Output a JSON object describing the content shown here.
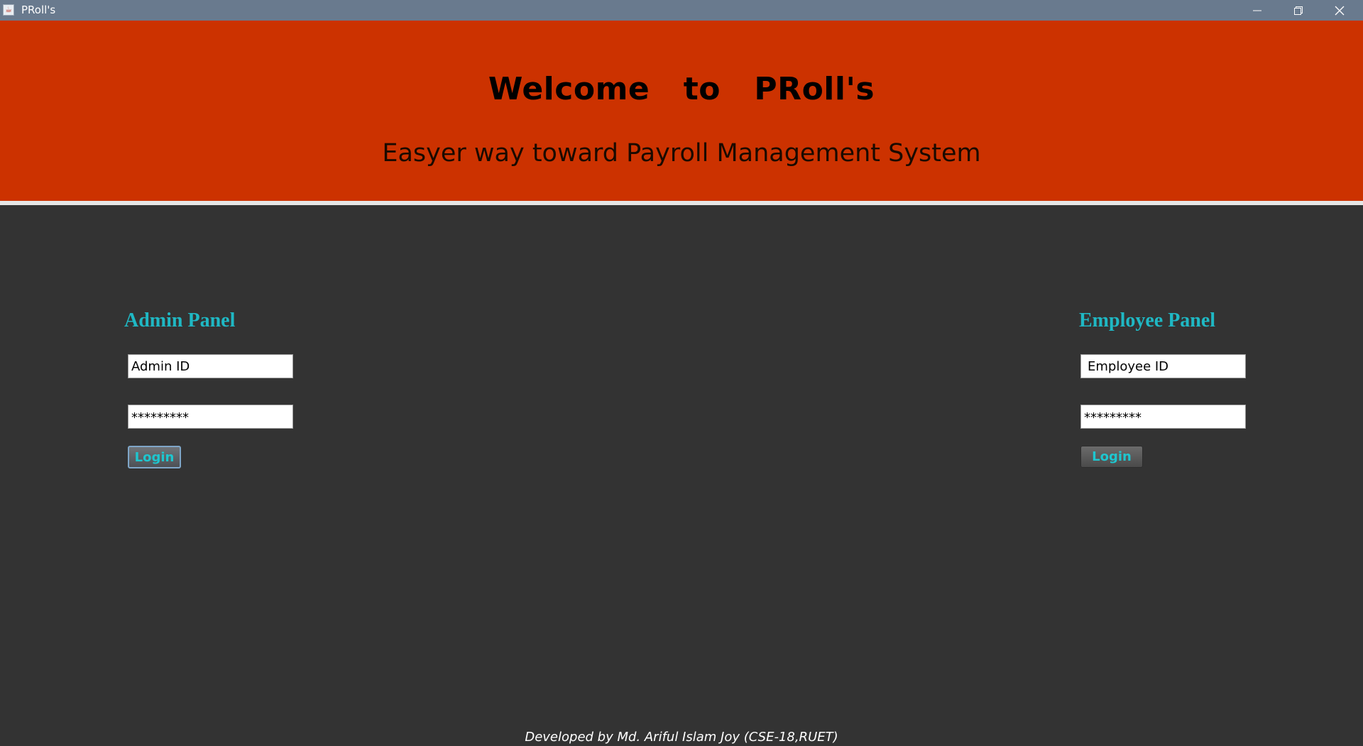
{
  "window": {
    "title": "PRoll's",
    "controls": {
      "minimize_icon": "minimize-icon",
      "maximize_icon": "restore-icon",
      "close_icon": "close-icon"
    }
  },
  "header": {
    "welcome": "Welcome   to   PRoll's",
    "subtitle": "Easyer way toward Payroll Management System",
    "background_color": "#cc3200"
  },
  "admin_panel": {
    "heading": "Admin Panel",
    "id_value": "Admin ID",
    "password_value": "*********",
    "login_label": "Login"
  },
  "employee_panel": {
    "heading": "Employee Panel",
    "id_value": "Employee ID",
    "password_value": "*********",
    "login_label": "Login"
  },
  "footer": {
    "credit": "Developed by Md. Ariful Islam Joy (CSE-18,RUET)"
  },
  "colors": {
    "accent": "#1fb8c4",
    "body_background": "#333333",
    "titlebar": "#697a8e"
  }
}
